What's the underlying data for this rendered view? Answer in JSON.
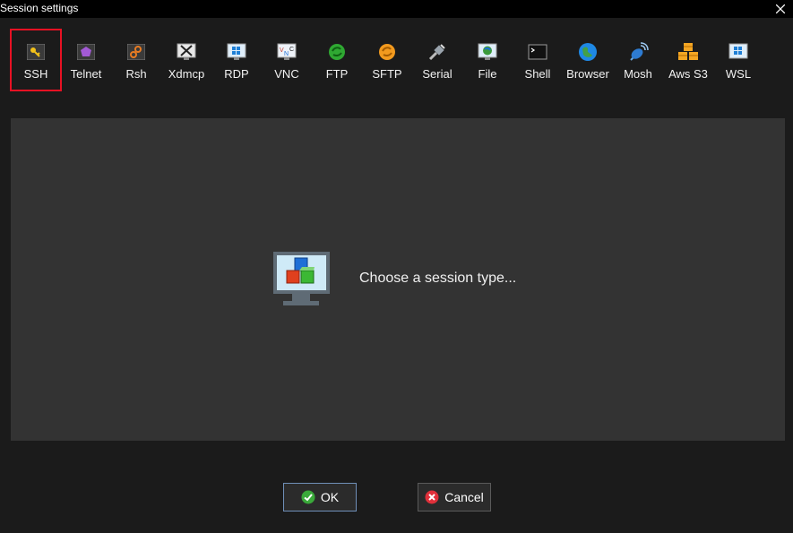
{
  "window": {
    "title": "Session settings",
    "close_icon": "close-icon"
  },
  "toolbar": {
    "items": [
      {
        "label": "SSH",
        "icon": "key-icon",
        "selected": true
      },
      {
        "label": "Telnet",
        "icon": "telnet-icon"
      },
      {
        "label": "Rsh",
        "icon": "rsh-icon"
      },
      {
        "label": "Xdmcp",
        "icon": "xdmcp-icon"
      },
      {
        "label": "RDP",
        "icon": "rdp-icon"
      },
      {
        "label": "VNC",
        "icon": "vnc-icon"
      },
      {
        "label": "FTP",
        "icon": "ftp-icon"
      },
      {
        "label": "SFTP",
        "icon": "sftp-icon"
      },
      {
        "label": "Serial",
        "icon": "serial-icon"
      },
      {
        "label": "File",
        "icon": "file-icon"
      },
      {
        "label": "Shell",
        "icon": "shell-icon"
      },
      {
        "label": "Browser",
        "icon": "browser-icon"
      },
      {
        "label": "Mosh",
        "icon": "mosh-icon"
      },
      {
        "label": "Aws S3",
        "icon": "aws-s3-icon"
      },
      {
        "label": "WSL",
        "icon": "wsl-icon"
      }
    ],
    "selected_color": "#e81123"
  },
  "main": {
    "prompt": "Choose a session type..."
  },
  "buttons": {
    "ok": "OK",
    "cancel": "Cancel"
  }
}
